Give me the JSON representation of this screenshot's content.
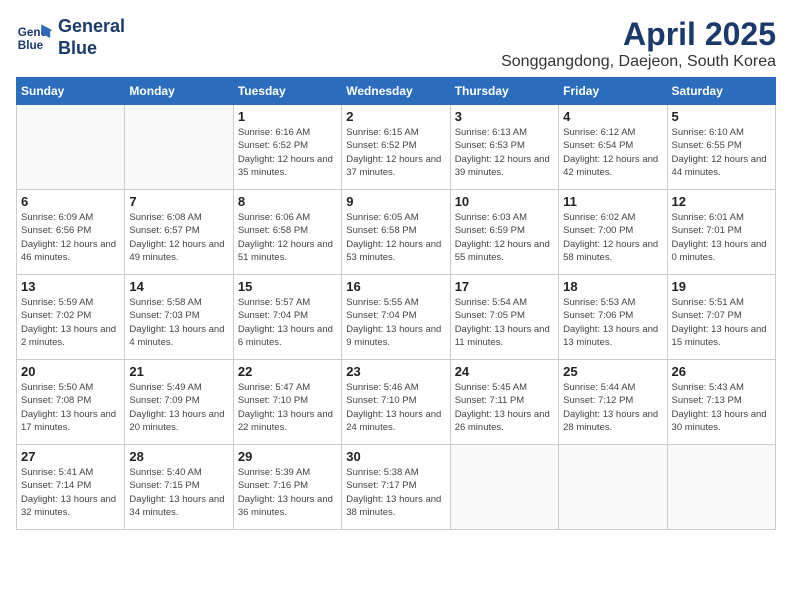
{
  "logo": {
    "line1": "General",
    "line2": "Blue"
  },
  "title": "April 2025",
  "subtitle": "Songgangdong, Daejeon, South Korea",
  "days_of_week": [
    "Sunday",
    "Monday",
    "Tuesday",
    "Wednesday",
    "Thursday",
    "Friday",
    "Saturday"
  ],
  "weeks": [
    [
      {
        "day": "",
        "info": ""
      },
      {
        "day": "",
        "info": ""
      },
      {
        "day": "1",
        "info": "Sunrise: 6:16 AM\nSunset: 6:52 PM\nDaylight: 12 hours and 35 minutes."
      },
      {
        "day": "2",
        "info": "Sunrise: 6:15 AM\nSunset: 6:52 PM\nDaylight: 12 hours and 37 minutes."
      },
      {
        "day": "3",
        "info": "Sunrise: 6:13 AM\nSunset: 6:53 PM\nDaylight: 12 hours and 39 minutes."
      },
      {
        "day": "4",
        "info": "Sunrise: 6:12 AM\nSunset: 6:54 PM\nDaylight: 12 hours and 42 minutes."
      },
      {
        "day": "5",
        "info": "Sunrise: 6:10 AM\nSunset: 6:55 PM\nDaylight: 12 hours and 44 minutes."
      }
    ],
    [
      {
        "day": "6",
        "info": "Sunrise: 6:09 AM\nSunset: 6:56 PM\nDaylight: 12 hours and 46 minutes."
      },
      {
        "day": "7",
        "info": "Sunrise: 6:08 AM\nSunset: 6:57 PM\nDaylight: 12 hours and 49 minutes."
      },
      {
        "day": "8",
        "info": "Sunrise: 6:06 AM\nSunset: 6:58 PM\nDaylight: 12 hours and 51 minutes."
      },
      {
        "day": "9",
        "info": "Sunrise: 6:05 AM\nSunset: 6:58 PM\nDaylight: 12 hours and 53 minutes."
      },
      {
        "day": "10",
        "info": "Sunrise: 6:03 AM\nSunset: 6:59 PM\nDaylight: 12 hours and 55 minutes."
      },
      {
        "day": "11",
        "info": "Sunrise: 6:02 AM\nSunset: 7:00 PM\nDaylight: 12 hours and 58 minutes."
      },
      {
        "day": "12",
        "info": "Sunrise: 6:01 AM\nSunset: 7:01 PM\nDaylight: 13 hours and 0 minutes."
      }
    ],
    [
      {
        "day": "13",
        "info": "Sunrise: 5:59 AM\nSunset: 7:02 PM\nDaylight: 13 hours and 2 minutes."
      },
      {
        "day": "14",
        "info": "Sunrise: 5:58 AM\nSunset: 7:03 PM\nDaylight: 13 hours and 4 minutes."
      },
      {
        "day": "15",
        "info": "Sunrise: 5:57 AM\nSunset: 7:04 PM\nDaylight: 13 hours and 6 minutes."
      },
      {
        "day": "16",
        "info": "Sunrise: 5:55 AM\nSunset: 7:04 PM\nDaylight: 13 hours and 9 minutes."
      },
      {
        "day": "17",
        "info": "Sunrise: 5:54 AM\nSunset: 7:05 PM\nDaylight: 13 hours and 11 minutes."
      },
      {
        "day": "18",
        "info": "Sunrise: 5:53 AM\nSunset: 7:06 PM\nDaylight: 13 hours and 13 minutes."
      },
      {
        "day": "19",
        "info": "Sunrise: 5:51 AM\nSunset: 7:07 PM\nDaylight: 13 hours and 15 minutes."
      }
    ],
    [
      {
        "day": "20",
        "info": "Sunrise: 5:50 AM\nSunset: 7:08 PM\nDaylight: 13 hours and 17 minutes."
      },
      {
        "day": "21",
        "info": "Sunrise: 5:49 AM\nSunset: 7:09 PM\nDaylight: 13 hours and 20 minutes."
      },
      {
        "day": "22",
        "info": "Sunrise: 5:47 AM\nSunset: 7:10 PM\nDaylight: 13 hours and 22 minutes."
      },
      {
        "day": "23",
        "info": "Sunrise: 5:46 AM\nSunset: 7:10 PM\nDaylight: 13 hours and 24 minutes."
      },
      {
        "day": "24",
        "info": "Sunrise: 5:45 AM\nSunset: 7:11 PM\nDaylight: 13 hours and 26 minutes."
      },
      {
        "day": "25",
        "info": "Sunrise: 5:44 AM\nSunset: 7:12 PM\nDaylight: 13 hours and 28 minutes."
      },
      {
        "day": "26",
        "info": "Sunrise: 5:43 AM\nSunset: 7:13 PM\nDaylight: 13 hours and 30 minutes."
      }
    ],
    [
      {
        "day": "27",
        "info": "Sunrise: 5:41 AM\nSunset: 7:14 PM\nDaylight: 13 hours and 32 minutes."
      },
      {
        "day": "28",
        "info": "Sunrise: 5:40 AM\nSunset: 7:15 PM\nDaylight: 13 hours and 34 minutes."
      },
      {
        "day": "29",
        "info": "Sunrise: 5:39 AM\nSunset: 7:16 PM\nDaylight: 13 hours and 36 minutes."
      },
      {
        "day": "30",
        "info": "Sunrise: 5:38 AM\nSunset: 7:17 PM\nDaylight: 13 hours and 38 minutes."
      },
      {
        "day": "",
        "info": ""
      },
      {
        "day": "",
        "info": ""
      },
      {
        "day": "",
        "info": ""
      }
    ]
  ]
}
